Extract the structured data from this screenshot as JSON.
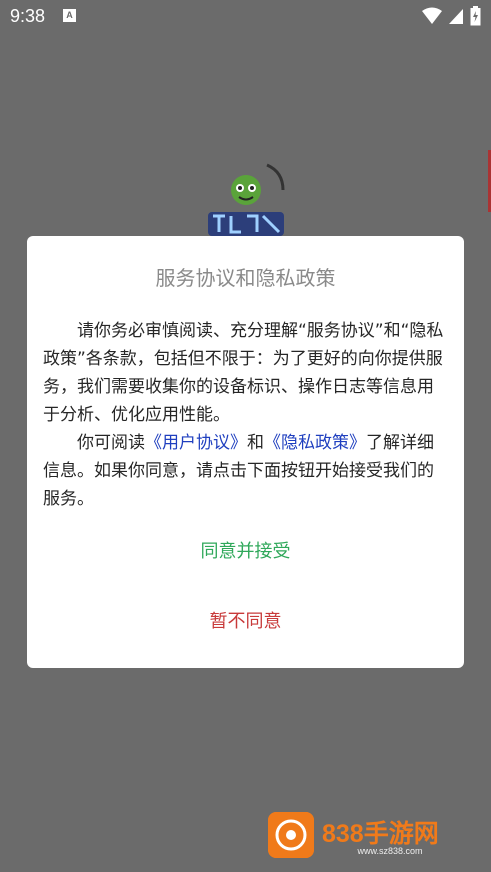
{
  "status_bar": {
    "time": "9:38",
    "notify_glyph": "A"
  },
  "dialog": {
    "title": "服务协议和隐私政策",
    "p1": "请你务必审慎阅读、充分理解“服务协议”和“隐私政策”各条款，包括但不限于：为了更好的向你提供服务，我们需要收集你的设备标识、操作日志等信息用于分析、优化应用性能。",
    "p2_pre": "你可阅读",
    "user_agreement_link": "《用户协议》",
    "p2_and": "和",
    "privacy_policy_link": "《隐私政策》",
    "p2_post": "了解详细信息。如果你同意，请点击下面按钮开始接受我们的服务。",
    "agree_label": "同意并接受",
    "disagree_label": "暂不同意"
  },
  "watermark": {
    "title": "838手游网",
    "url": "www.sz838.com"
  },
  "colors": {
    "agree": "#2fa85a",
    "disagree": "#c83a3a",
    "link": "#1f3fbf",
    "overlay": "#6b6b6b"
  }
}
